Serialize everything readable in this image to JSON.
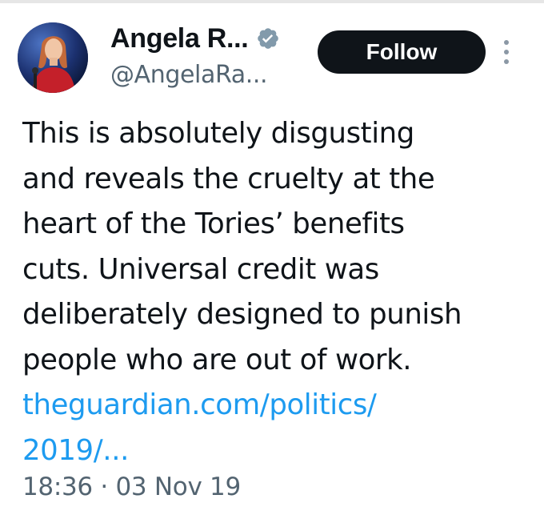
{
  "author": {
    "display_name": "Angela R...",
    "handle": "@AngelaRa...",
    "verified_badge_icon": "verified-badge-icon",
    "avatar_icon": "profile-photo"
  },
  "actions": {
    "follow_label": "Follow",
    "more_icon": "more-options-vertical-icon"
  },
  "tweet": {
    "lines": [
      "This is absolutely disgusting",
      "and reveals the cruelty at the",
      "heart of the Tories’ benefits",
      "cuts. Universal credit was",
      "deliberately designed to punish",
      "people who are out of work."
    ],
    "link_lines": [
      "theguardian.com/politics/",
      "2019/..."
    ],
    "timestamp": "18:36 · 03 Nov 19"
  },
  "colors": {
    "text": "#0f1419",
    "secondary_text": "#536471",
    "link": "#1d9bf0",
    "follow_button_bg": "#0f1419",
    "follow_button_text": "#ffffff"
  }
}
